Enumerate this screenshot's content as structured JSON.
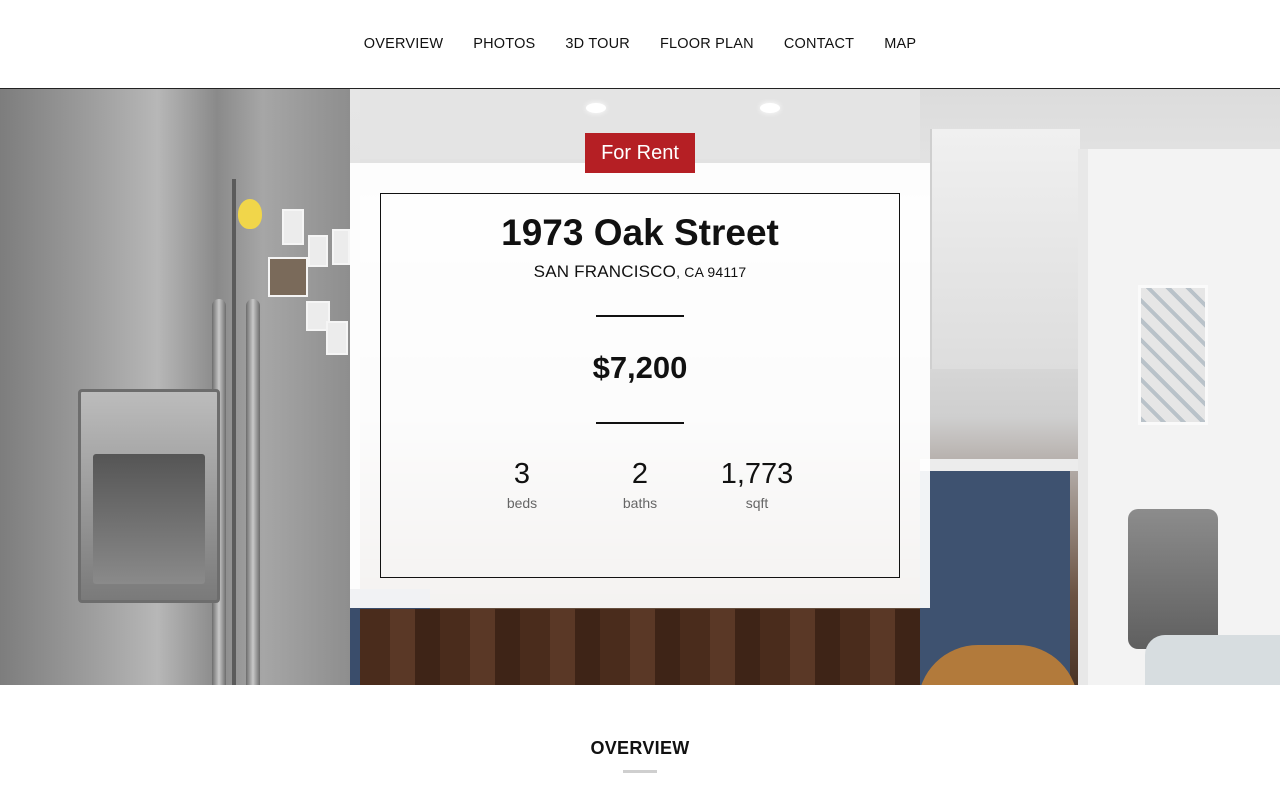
{
  "nav": {
    "items": [
      {
        "label": "OVERVIEW"
      },
      {
        "label": "PHOTOS"
      },
      {
        "label": "3D TOUR"
      },
      {
        "label": "FLOOR PLAN"
      },
      {
        "label": "CONTACT"
      },
      {
        "label": "MAP"
      }
    ]
  },
  "listing": {
    "status": "For Rent",
    "street": "1973 Oak Street",
    "city": "SAN FRANCISCO",
    "state_zip": ", CA 94117",
    "price": "$7,200",
    "stats": [
      {
        "value": "3",
        "label": "beds"
      },
      {
        "value": "2",
        "label": "baths"
      },
      {
        "value": "1,773",
        "label": "sqft"
      }
    ]
  },
  "overview": {
    "title": "OVERVIEW"
  },
  "colors": {
    "badge": "#b51f24",
    "text": "#111111",
    "muted": "#666666"
  }
}
